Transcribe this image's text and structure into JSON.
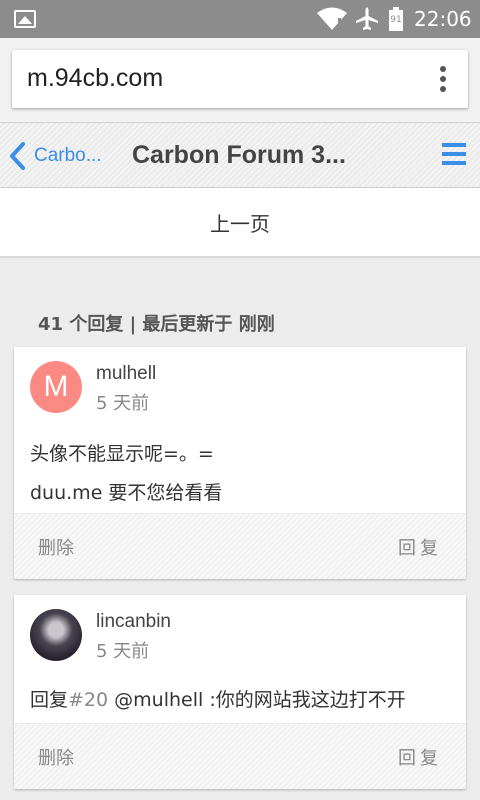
{
  "status_bar": {
    "time": "22:06",
    "icons": [
      "image-icon",
      "wifi-icon",
      "airplane-icon",
      "battery-icon"
    ],
    "battery_label": "91"
  },
  "browser": {
    "url": "m.94cb.com",
    "menu_icon": "more-vert-icon"
  },
  "forum_header": {
    "back_label": "Carbo...",
    "title": "Carbon Forum 3...",
    "accent_color": "#3a8ee6"
  },
  "pagination": {
    "prev_label": "上一页"
  },
  "topic": {
    "reply_summary": "41 个回复 | 最后更新于 刚刚"
  },
  "posts": [
    {
      "avatar_letter": "M",
      "avatar_color": "#fb8a84",
      "username": "mulhell",
      "time": "5 天前",
      "lines": [
        "头像不能显示呢=。=",
        "duu.me 要不您给看看"
      ],
      "delete_label": "删除",
      "reply_label": "回复"
    },
    {
      "username": "lincanbin",
      "time": "5 天前",
      "reply_prefix": "回复",
      "reply_ref": "#20",
      "reply_text": " @mulhell :你的网站我这边打不开",
      "delete_label": "删除",
      "reply_label": "回复"
    }
  ]
}
